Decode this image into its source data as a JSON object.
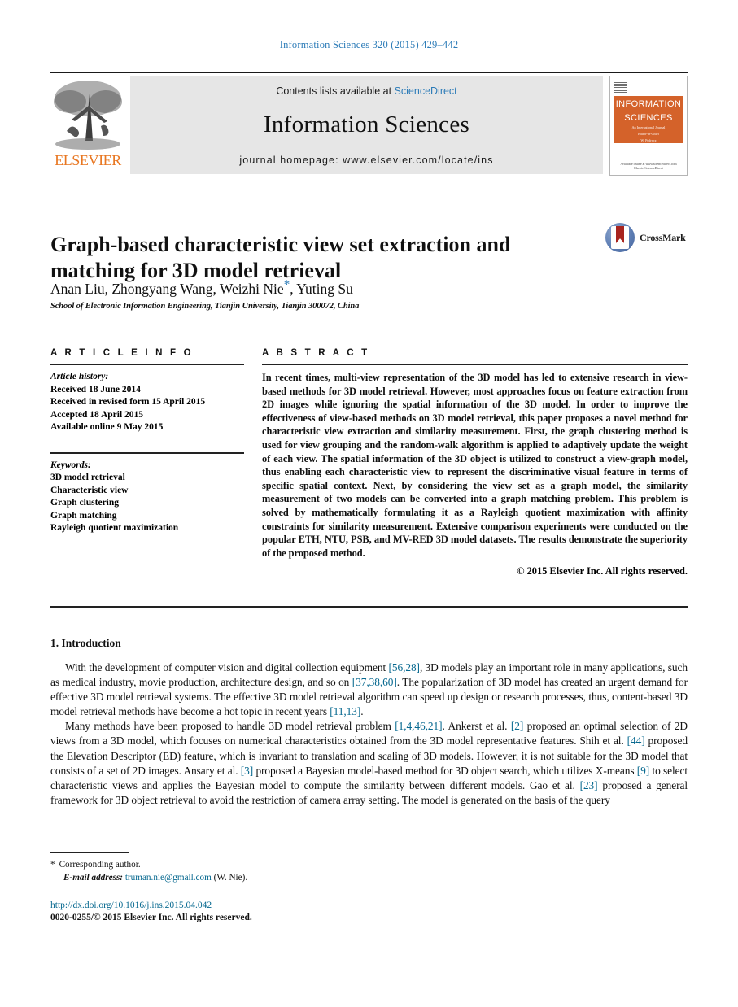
{
  "running_head": "Information Sciences 320 (2015) 429–442",
  "masthead": {
    "publisher_wordmark": "ELSEVIER",
    "contents_prefix": "Contents lists available at",
    "contents_link": "ScienceDirect",
    "journal_name": "Information Sciences",
    "homepage": "journal homepage: www.elsevier.com/locate/ins",
    "cover": {
      "line1": "INFORMATION",
      "line2": "SCIENCES",
      "subtitle": "An International Journal",
      "editor": "Editor-in-Chief",
      "editor_name": "W. Pedrycz",
      "tagline": "AN INTERNATIONAL JOURNAL",
      "footer": "Available online at www.sciencedirect.com",
      "publisher": "ElsevierScienceDirect"
    }
  },
  "article": {
    "title": "Graph-based characteristic view set extraction and matching for 3D model retrieval",
    "authors_pre": "Anan Liu, Zhongyang Wang, Weizhi Nie",
    "corresponding_mark": "*",
    "authors_post": ", Yuting Su",
    "affiliation": "School of Electronic Information Engineering, Tianjin University, Tianjin 300072, China",
    "crossmark_label": "CrossMark"
  },
  "info": {
    "heading": "A R T I C L E   I N F O",
    "history_label": "Article history:",
    "history": [
      "Received 18 June 2014",
      "Received in revised form 15 April 2015",
      "Accepted 18 April 2015",
      "Available online 9 May 2015"
    ],
    "keywords_label": "Keywords:",
    "keywords": [
      "3D model retrieval",
      "Characteristic view",
      "Graph clustering",
      "Graph matching",
      "Rayleigh quotient maximization"
    ]
  },
  "abstract": {
    "heading": "A B S T R A C T",
    "text": "In recent times, multi-view representation of the 3D model has led to extensive research in view-based methods for 3D model retrieval. However, most approaches focus on feature extraction from 2D images while ignoring the spatial information of the 3D model. In order to improve the effectiveness of view-based methods on 3D model retrieval, this paper proposes a novel method for characteristic view extraction and similarity measurement. First, the graph clustering method is used for view grouping and the random-walk algorithm is applied to adaptively update the weight of each view. The spatial information of the 3D object is utilized to construct a view-graph model, thus enabling each characteristic view to represent the discriminative visual feature in terms of specific spatial context. Next, by considering the view set as a graph model, the similarity measurement of two models can be converted into a graph matching problem. This problem is solved by mathematically formulating it as a Rayleigh quotient maximization with affinity constraints for similarity measurement. Extensive comparison experiments were conducted on the popular ETH, NTU, PSB, and MV-RED 3D model datasets. The results demonstrate the superiority of the proposed method.",
    "copyright": "© 2015 Elsevier Inc. All rights reserved."
  },
  "body": {
    "section_heading": "1. Introduction",
    "paragraph1": {
      "s1": "With the development of computer vision and digital collection equipment ",
      "r1": "[56,28]",
      "s2": ", 3D models play an important role in many applications, such as medical industry, movie production, architecture design, and so on ",
      "r2": "[37,38,60]",
      "s3": ". The popularization of 3D model has created an urgent demand for effective 3D model retrieval systems. The effective 3D model retrieval algorithm can speed up design or research processes, thus, content-based 3D model retrieval methods have become a hot topic in recent years ",
      "r3": "[11,13]",
      "s4": "."
    },
    "paragraph2": {
      "s1": "Many methods have been proposed to handle 3D model retrieval problem ",
      "r1": "[1,4,46,21]",
      "s2": ". Ankerst et al. ",
      "r2": "[2]",
      "s3": " proposed an optimal selection of 2D views from a 3D model, which focuses on numerical characteristics obtained from the 3D model representative features. Shih et al. ",
      "r3": "[44]",
      "s4": " proposed the Elevation Descriptor (ED) feature, which is invariant to translation and scaling of 3D models. However, it is not suitable for the 3D model that consists of a set of 2D images. Ansary et al. ",
      "r4": "[3]",
      "s5": " proposed a Bayesian model-based method for 3D object search, which utilizes X-means ",
      "r5": "[9]",
      "s6": " to select characteristic views and applies the Bayesian model to compute the similarity between different models. Gao et al. ",
      "r6": "[23]",
      "s7": " proposed a general framework for 3D object retrieval to avoid the restriction of camera array setting. The model is generated on the basis of the query"
    }
  },
  "footnote": {
    "star": "*",
    "corresponding": "Corresponding author.",
    "email_label": "E-mail address:",
    "email": "truman.nie@gmail.com",
    "email_owner": "(W. Nie).",
    "doi": "http://dx.doi.org/10.1016/j.ins.2015.04.042",
    "issn_line": "0020-0255/© 2015 Elsevier Inc. All rights reserved."
  },
  "colors": {
    "link_blue": "#2d7cb8",
    "ref_blue": "#06688f",
    "elsevier_orange": "#e87722",
    "band_gray": "#e6e6e6"
  }
}
